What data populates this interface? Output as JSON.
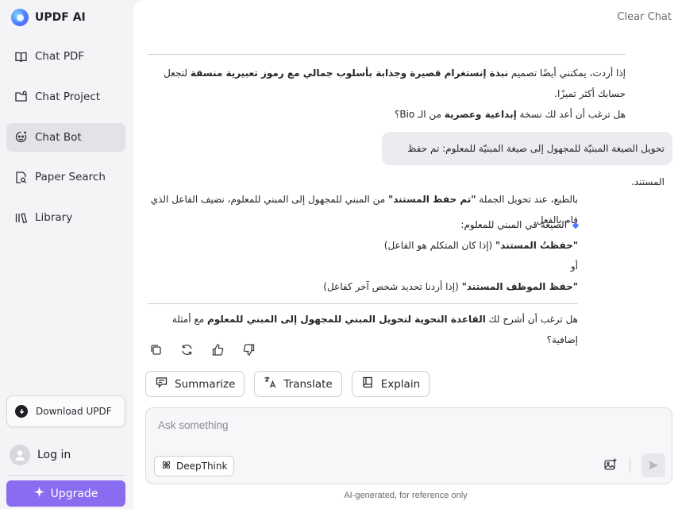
{
  "brand": {
    "name": "UPDF AI",
    "icon": "updf-logo-icon"
  },
  "sidebar": {
    "items": [
      {
        "label": "Chat PDF",
        "icon": "chat-pdf-icon"
      },
      {
        "label": "Chat Project",
        "icon": "folder-icon"
      },
      {
        "label": "Chat Bot",
        "icon": "bot-icon",
        "active": true
      },
      {
        "label": "Paper Search",
        "icon": "paper-search-icon"
      },
      {
        "label": "Library",
        "icon": "library-icon"
      }
    ],
    "download_label": "Download UPDF",
    "login_label": "Log in",
    "upgrade_label": "Upgrade"
  },
  "header": {
    "clear_chat": "Clear Chat"
  },
  "conversation": {
    "msg1": {
      "line1_pre": "إذا أردت، يمكنني أيضًا تصميم ",
      "line1_bold1": "نبذة إنستغرام قصيرة وجذابة بأسلوب جمالي مع رموز تعبيرية منسقة",
      "line1_post": " لتجعل حسابك أكثر تميزًا.",
      "line2_pre": "هل ترغب أن أعد لك نسخة ",
      "line2_bold": "إبداعية وعصرية",
      "line2_post": " من الـ Bio؟"
    },
    "user_bubble": "تحويل الصيغة المبنيّة للمجهول إلى صيغة المبنيّة للمعلوم: تم حفظ المستند.",
    "msg2": {
      "intro_pre": "بالطبع، عند تحويل الجملة ",
      "intro_bold": "\"تم حفظ المستند\"",
      "intro_post": " من المبني للمجهول إلى المبني للمعلوم، نضيف الفاعل الذي قام بالفعل.",
      "bullet_label": "الصيغة في المبني للمعلوم:",
      "option1_bold": "\"حفظتُ المستند\"",
      "option1_note": " (إذا كان المتكلم هو الفاعل)",
      "or_word": "أو",
      "option2_bold": "\"حفظ الموظف المستند\"",
      "option2_note": " (إذا أردنا تحديد شخص آخر كفاعل)",
      "question_pre": "هل ترغب أن أشرح لك ",
      "question_bold": "القاعدة النحوية لتحويل المبني للمجهول إلى المبني للمعلوم",
      "question_post": " مع أمثلة إضافية؟"
    }
  },
  "message_actions": [
    "copy-icon",
    "regenerate-icon",
    "thumbs-up-icon",
    "thumbs-down-icon"
  ],
  "tools": [
    {
      "label": "Summarize",
      "icon": "summarize-icon"
    },
    {
      "label": "Translate",
      "icon": "translate-icon"
    },
    {
      "label": "Explain",
      "icon": "book-icon"
    }
  ],
  "composer": {
    "placeholder": "Ask something",
    "deepthink_label": "DeepThink"
  },
  "footer_note": "AI-generated, for reference only",
  "colors": {
    "accent": "#8a6cf0",
    "active_bg": "#e2e2e7",
    "bullet": "#4a7bff"
  }
}
